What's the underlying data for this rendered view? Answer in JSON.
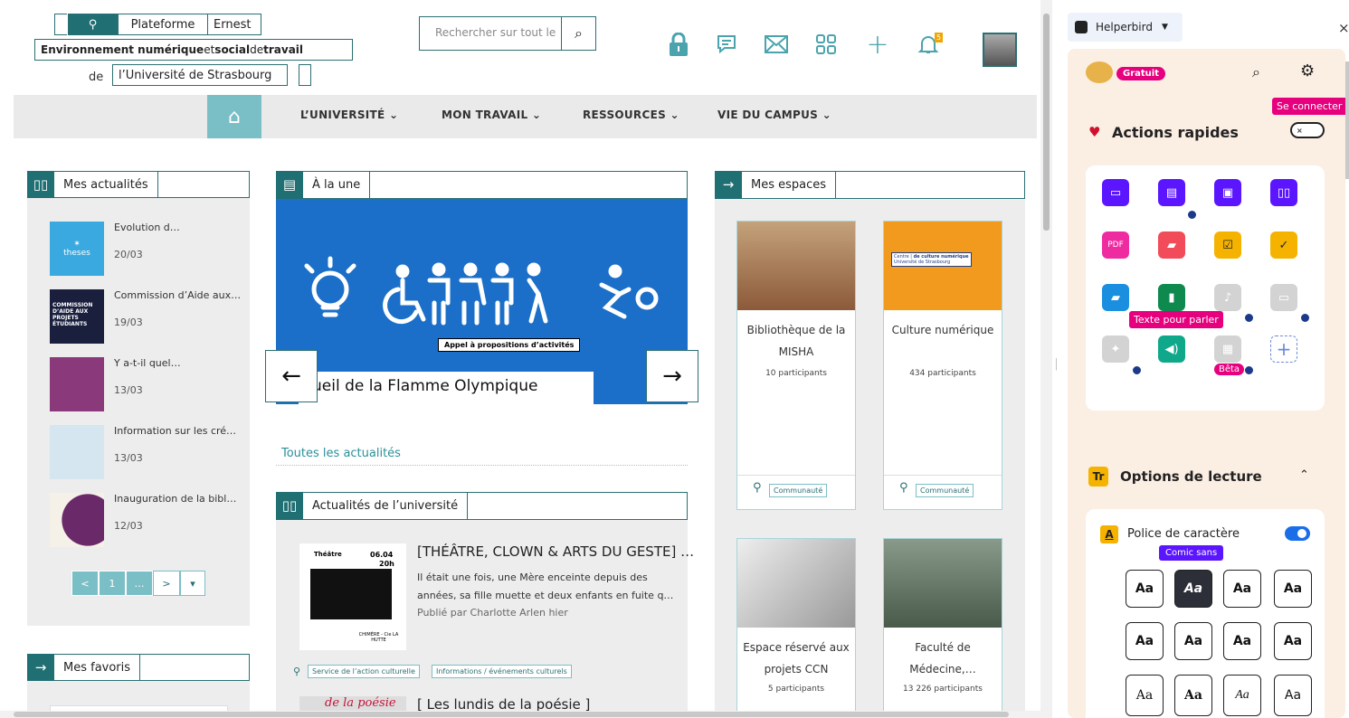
{
  "header": {
    "platform_line1": "Plateforme",
    "platform_name": "Ernest",
    "tagline_parts": [
      "Environnement numérique",
      " et ",
      "social",
      " de ",
      "travail"
    ],
    "university_prefix": "de",
    "university_name": "l’Université de Strasbourg",
    "search_placeholder": "Rechercher sur tout le",
    "notif_count": "5"
  },
  "nav": {
    "items": [
      "L’UNIVERSITÉ ⌄",
      "MON TRAVAIL ⌄",
      "RESSOURCES ⌄",
      "VIE DU CAMPUS ⌄"
    ]
  },
  "mes_actualites": {
    "title": "Mes actualités",
    "items": [
      {
        "title": "Evolution d…",
        "date": "20/03"
      },
      {
        "title": "Commission d’Aide aux…",
        "date": "19/03"
      },
      {
        "title": "Y a-t-il quel…",
        "date": "13/03"
      },
      {
        "title": "Information sur les cré…",
        "date": "13/03"
      },
      {
        "title": "Inauguration de la bibl…",
        "date": "12/03"
      }
    ],
    "thumb1_text": "theses",
    "thumb2_text": "COMMISSION D’AIDE AUX PROJETS ÉTUDIANTS",
    "pager": [
      "<",
      "1",
      "…",
      ">",
      "▾"
    ]
  },
  "mes_favoris": {
    "title": "Mes favoris"
  },
  "a_la_une": {
    "title": "À la une",
    "banner_text": "Appel à propositions d’activités",
    "caption": "ueil de la Flamme Olympique",
    "prev": "←",
    "next": "→",
    "all_link": "Toutes les actualités"
  },
  "actualites_univ": {
    "title": "Actualités de l’université",
    "item_title": "[THÉÂTRE, CLOWN & ARTS DU GESTE] …",
    "item_body": "Il était une fois, une Mère enceinte depuis des années, sa fille muette et deux enfants en fuite q…",
    "item_meta": "Publié par Charlotte Arlen hier",
    "thumb_label": "Théâtre",
    "thumb_date": "06.04",
    "thumb_time": "20h",
    "thumb_footer": "CHIMÈRE - Cie LA HUTTE",
    "tags": [
      "Service de l’action culturelle",
      "Informations / événements culturels"
    ],
    "item2_thumb": "de la poésie",
    "item2_title": "[ Les lundis de la poésie ]"
  },
  "mes_espaces": {
    "title": "Mes espaces",
    "cards": [
      {
        "name": "Bibliothèque de la MISHA",
        "participants": "10 participants",
        "tag": "Communauté"
      },
      {
        "name": "Culture numérique",
        "participants": "434 participants",
        "tag": "Communauté"
      },
      {
        "name": "Espace réservé aux projets CCN",
        "participants": "5 participants"
      },
      {
        "name": "Faculté de Médecine,…",
        "participants": "13 226 participants"
      }
    ],
    "card2_logo_a": "Centre",
    "card2_logo_b": "de culture numérique",
    "card2_logo_c": "Université de Strasbourg"
  },
  "helperbird": {
    "app_name": "Helperbird",
    "plan_badge": "Gratuit",
    "login_tip": "Se connecter",
    "quick_actions": "Actions rapides",
    "tts_tip": "Texte pour parler",
    "beta_label": "Bêta",
    "reading_options": "Options de lecture",
    "font_label": "Police de caractère",
    "font_tip": "Comic sans",
    "font_sample": "Aa",
    "close": "×"
  },
  "colors": {
    "teal": "#1f6f73",
    "light_teal": "#7bbfc6",
    "carousel_blue": "#1b6fc8",
    "pink": "#e6007e",
    "purple": "#5b16ff"
  }
}
